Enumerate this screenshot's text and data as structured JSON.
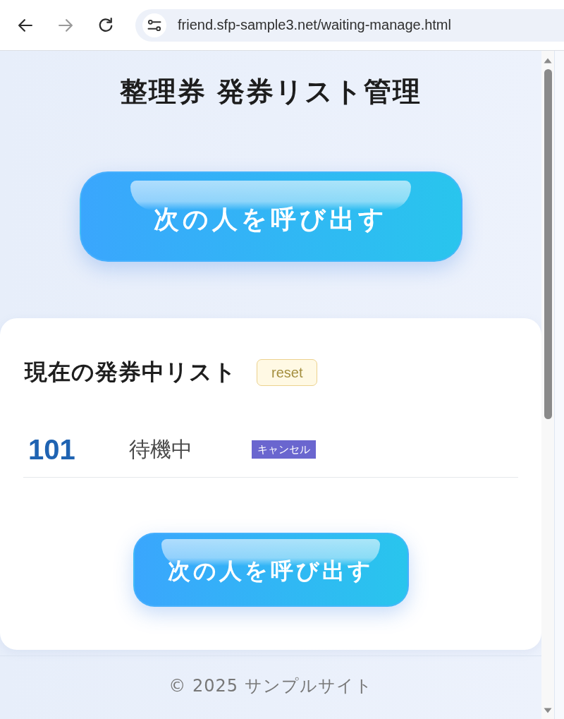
{
  "toolbar": {
    "nav_buttons": [
      {
        "kind": "back",
        "disabled": false
      },
      {
        "kind": "forward",
        "disabled": true
      },
      {
        "kind": "reload",
        "disabled": false
      }
    ],
    "url": "friend.sfp-sample3.net/waiting-manage.html"
  },
  "page": {
    "title": "整理券 発券リスト管理"
  },
  "call_button_top": {
    "label": "次の人を呼び出す"
  },
  "list": {
    "heading": "現在の発券中リスト",
    "reset_label": "reset",
    "tickets": [
      {
        "number": "101",
        "status": "待機中",
        "cancel_label": "キャンセル"
      }
    ]
  },
  "call_button_bottom": {
    "label": "次の人を呼び出す"
  },
  "footer": {
    "text": "© 2025 サンプルサイト"
  }
}
